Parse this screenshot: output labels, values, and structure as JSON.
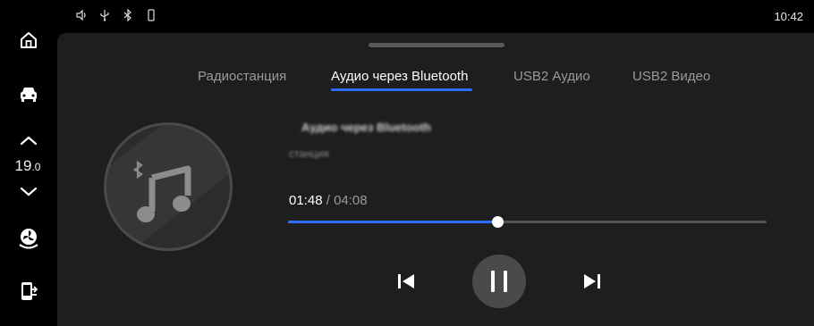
{
  "status_bar": {
    "icons": [
      "volume-icon",
      "usb-icon",
      "bluetooth-icon",
      "phone-icon"
    ],
    "time": "10:42"
  },
  "rail": {
    "items": [
      "home-icon",
      "car-icon",
      "chevron-up-icon",
      "chevron-down-icon",
      "fan-icon",
      "phone-mirror-icon"
    ],
    "temperature": {
      "whole": "19",
      "decimal": ".0"
    }
  },
  "tabs": [
    {
      "label": "Радиостанция",
      "active": false
    },
    {
      "label": "Аудио через Bluetooth",
      "active": true
    },
    {
      "label": "USB2 Аудио",
      "active": false
    },
    {
      "label": "USB2 Видео",
      "active": false
    }
  ],
  "track": {
    "title": "Аудио через Bluetooth",
    "subtitle": "станция"
  },
  "playback": {
    "current_time": "01:48",
    "separator": " / ",
    "total_time": "04:08",
    "progress": 0.437
  },
  "colors": {
    "accent": "#2f6dff",
    "panel": "#1e1e1e",
    "background": "#000000"
  }
}
